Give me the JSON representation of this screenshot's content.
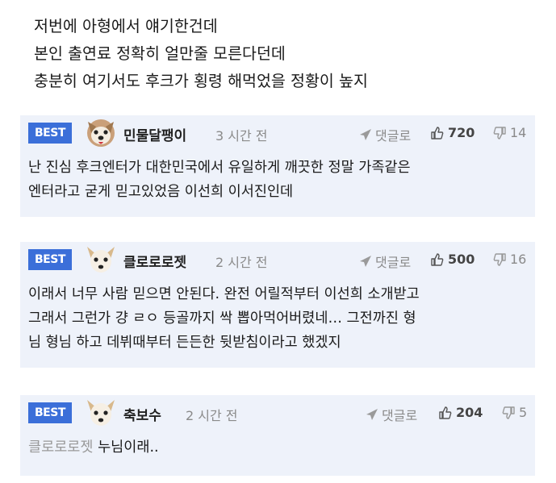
{
  "post": {
    "lines": [
      "저번에 아형에서 얘기한건데",
      "본인 출연료 정확히 얼만줄 모른다던데",
      "충분히 여기서도 후크가 횡령 해먹었을 정황이 높지"
    ]
  },
  "comments": [
    {
      "badge": "BEST",
      "nickname": "민물달팽이",
      "time": "3 시간 전",
      "reply_label": "댓글로",
      "likes": "720",
      "dislikes": "14",
      "text_lines": [
        "난 진심 후크엔터가 대한민국에서 유일하게 깨끗한 정말 가족같은",
        "엔터라고 굳게 믿고있었음 이선희 이서진인데"
      ]
    },
    {
      "badge": "BEST",
      "nickname": "클로로로젯",
      "time": "2 시간 전",
      "reply_label": "댓글로",
      "likes": "500",
      "dislikes": "16",
      "text_lines": [
        "이래서 너무 사람 믿으면 안된다. 완전 어릴적부터 이선희 소개받고",
        "그래서 그런가 걍 ㄹㅇ 등골까지 싹 뽑아먹어버렸네… 그전까진 형",
        "님 형님 하고 데뷔때부터 든든한 뒷받침이라고 했겠지"
      ]
    },
    {
      "badge": "BEST",
      "nickname": "축보수",
      "time": "2 시간 전",
      "reply_label": "댓글로",
      "likes": "204",
      "dislikes": "5",
      "mention": "클로로로젯",
      "text": "누님이래.."
    }
  ],
  "icons": {
    "reply": "send-arrow-icon",
    "like": "thumbs-up-icon",
    "dislike": "thumbs-down-icon"
  },
  "colors": {
    "badge_bg": "#3b6fd9",
    "card_bg": "#eef2fa",
    "muted": "#8a8a8a"
  }
}
